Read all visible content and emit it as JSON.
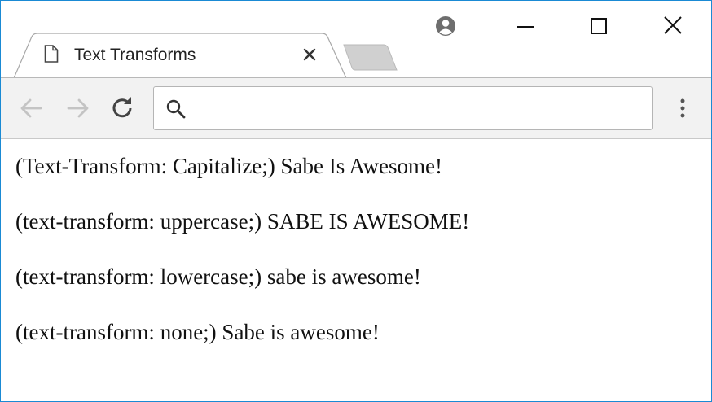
{
  "browser": {
    "tab": {
      "title": "Text Transforms"
    },
    "omnibox": {
      "value": "",
      "placeholder": ""
    },
    "icons": {
      "favicon": "page-icon",
      "close": "close-icon",
      "profile": "profile-icon",
      "minimize": "minimize-icon",
      "maximize": "maximize-icon",
      "window_close": "close-icon",
      "back": "back-arrow-icon",
      "forward": "forward-arrow-icon",
      "reload": "reload-icon",
      "search": "search-icon",
      "menu": "kebab-menu-icon"
    },
    "colors": {
      "window_border": "#1a8ad4",
      "toolbar": "#f2f2f2",
      "tab_inactive": "#d0d0d0"
    }
  },
  "content": {
    "lines": [
      {
        "prefix": "(text-transform: capitalize;)",
        "text": "Sabe Is Awesome!"
      },
      {
        "prefix": "(text-transform: uppercase;)",
        "text": "SABE IS AWESOME!"
      },
      {
        "prefix": "(text-transform: lowercase;)",
        "text": "sabe is awesome!"
      },
      {
        "prefix": "(text-transform: none;)",
        "text": "Sabe is awesome!"
      }
    ]
  }
}
